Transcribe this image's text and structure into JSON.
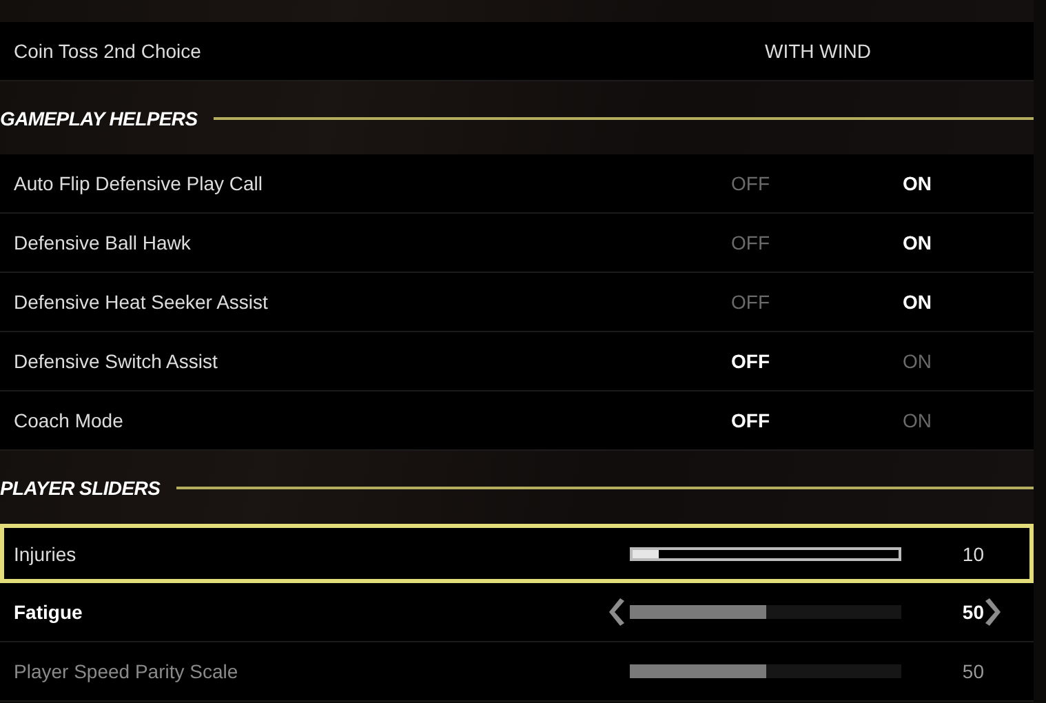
{
  "items": [
    {
      "kind": "choice",
      "label": "Coin Toss 2nd Choice",
      "value": "WITH WIND"
    },
    {
      "kind": "header",
      "label": "GAMEPLAY HELPERS"
    },
    {
      "kind": "toggle",
      "label": "Auto Flip Defensive Play Call",
      "options": [
        {
          "label": "OFF",
          "selected": false
        },
        {
          "label": "ON",
          "selected": true
        }
      ]
    },
    {
      "kind": "toggle",
      "label": "Defensive Ball Hawk",
      "options": [
        {
          "label": "OFF",
          "selected": false
        },
        {
          "label": "ON",
          "selected": true
        }
      ]
    },
    {
      "kind": "toggle",
      "label": "Defensive Heat Seeker Assist",
      "options": [
        {
          "label": "OFF",
          "selected": false
        },
        {
          "label": "ON",
          "selected": true
        }
      ]
    },
    {
      "kind": "toggle",
      "label": "Defensive Switch Assist",
      "options": [
        {
          "label": "OFF",
          "selected": true
        },
        {
          "label": "ON",
          "selected": false
        }
      ]
    },
    {
      "kind": "toggle",
      "label": "Coach Mode",
      "options": [
        {
          "label": "OFF",
          "selected": true
        },
        {
          "label": "ON",
          "selected": false
        }
      ]
    },
    {
      "kind": "header",
      "label": "PLAYER SLIDERS"
    },
    {
      "kind": "slider",
      "label": "Injuries",
      "level": 0.1,
      "value": "10",
      "selected": true,
      "arrows": false,
      "disabled": false
    },
    {
      "kind": "slider",
      "label": "Fatigue",
      "level": 0.5,
      "value": "50",
      "selected": false,
      "arrows": true,
      "disabled": false
    },
    {
      "kind": "slider",
      "label": "Player Speed Parity Scale",
      "level": 0.5,
      "value": "50",
      "selected": false,
      "arrows": false,
      "disabled": true
    }
  ]
}
